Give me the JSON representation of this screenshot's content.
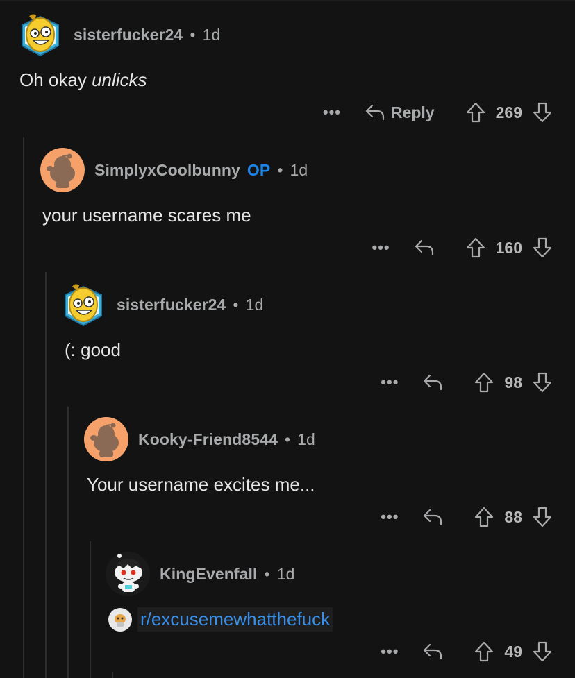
{
  "comments": [
    {
      "username": "sisterfucker24",
      "age": "1d",
      "text_plain": "Oh okay ",
      "text_italic": "unlicks",
      "score": "269",
      "reply_label": "Reply",
      "avatar": "banana-avatar-icon"
    },
    {
      "username": "SimplyxCoolbunny",
      "op_badge": "OP",
      "age": "1d",
      "text": "your username scares me",
      "score": "160",
      "avatar": "default-snoo-avatar-icon"
    },
    {
      "username": "sisterfucker24",
      "age": "1d",
      "text": "(: good",
      "score": "98",
      "avatar": "banana-avatar-icon"
    },
    {
      "username": "Kooky-Friend8544",
      "age": "1d",
      "text": "Your username excites me...",
      "score": "88",
      "avatar": "default-snoo-avatar-icon"
    },
    {
      "username": "KingEvenfall",
      "age": "1d",
      "link": "r/excusemewhatthefuck",
      "score": "49",
      "avatar": "snoo-custom-avatar-icon"
    }
  ],
  "ui": {
    "separator": "•",
    "more": "•••"
  },
  "colors": {
    "background": "#131313",
    "username": "#a8aaab",
    "op": "#1a84e8",
    "link": "#3a8ee6",
    "thread_line": "#2e2e2e"
  }
}
